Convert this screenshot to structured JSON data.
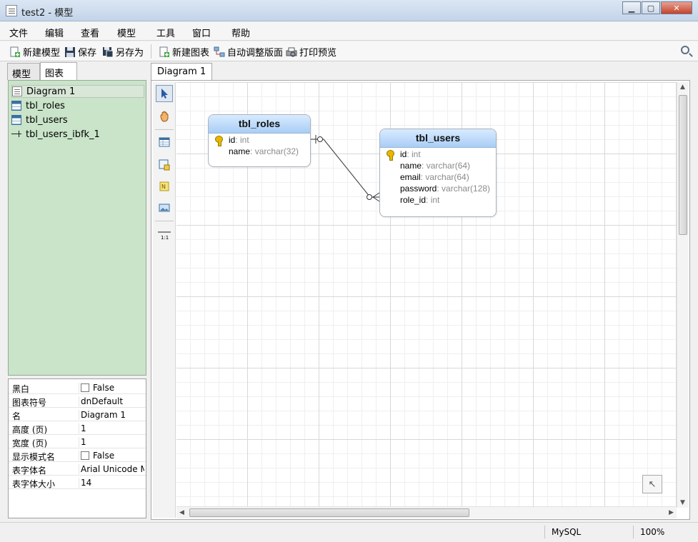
{
  "window": {
    "title": "test2 - 模型"
  },
  "menu": [
    "文件",
    "编辑",
    "查看",
    "模型",
    "工具",
    "窗口",
    "帮助"
  ],
  "toolbar": {
    "new_model": "新建模型",
    "save": "保存",
    "save_as": "另存为",
    "new_diagram": "新建图表",
    "auto_layout": "自动调整版面",
    "print_preview": "打印预览"
  },
  "left_tabs": {
    "model": "模型",
    "diagram": "图表"
  },
  "tree": [
    {
      "label": "Diagram 1",
      "icon": "diagram-icon"
    },
    {
      "label": "tbl_roles",
      "icon": "table-icon"
    },
    {
      "label": "tbl_users",
      "icon": "table-icon"
    },
    {
      "label": "tbl_users_ibfk_1",
      "icon": "foreign-key-icon"
    }
  ],
  "properties": [
    {
      "name": "黑白",
      "value": "False",
      "checkbox": true
    },
    {
      "name": "图表符号",
      "value": "dnDefault"
    },
    {
      "name": "名",
      "value": "Diagram 1"
    },
    {
      "name": "高度 (页)",
      "value": "1"
    },
    {
      "name": "宽度 (页)",
      "value": "1"
    },
    {
      "name": "显示模式名",
      "value": "False",
      "checkbox": true
    },
    {
      "name": "表字体名",
      "value": "Arial Unicode MS"
    },
    {
      "name": "表字体大小",
      "value": "14"
    }
  ],
  "diagram_tab": "Diagram 1",
  "palette": {
    "ratio_label": "1:1"
  },
  "entities": {
    "roles": {
      "name": "tbl_roles",
      "fields": [
        {
          "name": "id",
          "type": ": int",
          "key": true
        },
        {
          "name": "name",
          "type": ": varchar(32)"
        }
      ]
    },
    "users": {
      "name": "tbl_users",
      "fields": [
        {
          "name": "id",
          "type": ": int",
          "key": true
        },
        {
          "name": "name",
          "type": ": varchar(64)"
        },
        {
          "name": "email",
          "type": ": varchar(64)"
        },
        {
          "name": "password",
          "type": ": varchar(128)"
        },
        {
          "name": "role_id",
          "type": ": int"
        }
      ]
    }
  },
  "status": {
    "database": "MySQL",
    "zoom": "100%"
  },
  "colors": {
    "tree_bg": "#c9e4c8",
    "entity_header": "#a9cdf5"
  }
}
